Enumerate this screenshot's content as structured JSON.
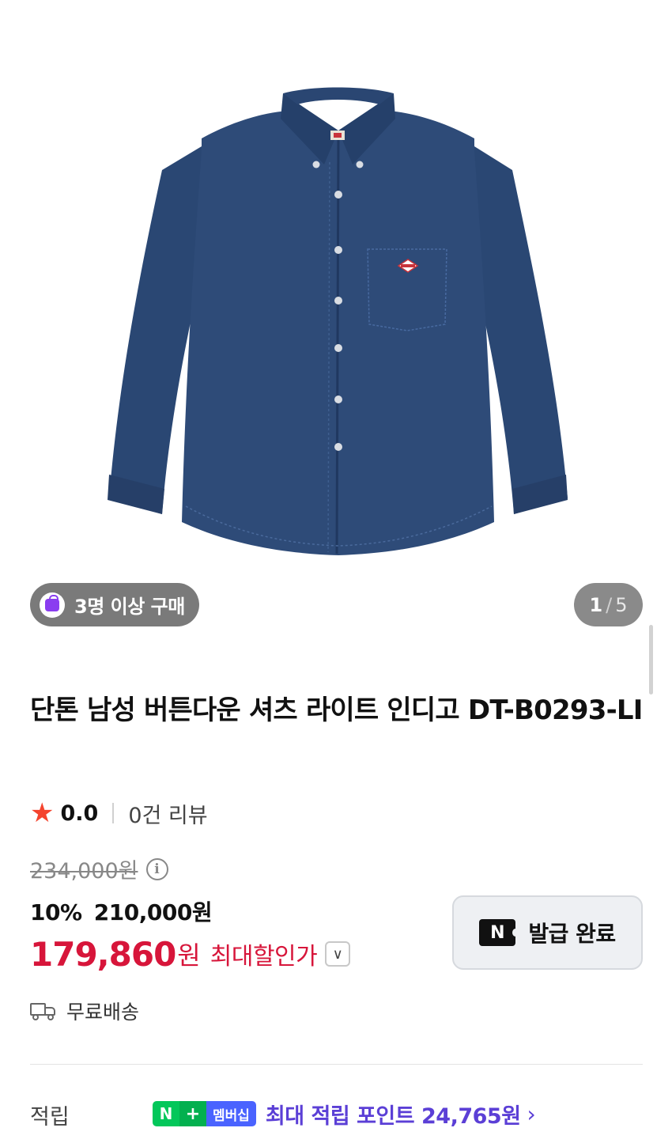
{
  "product_image": {
    "alt_icon": "denim-shirt",
    "colors": {
      "denim": "#2e4b78",
      "denim_dark": "#243d63",
      "stitch": "#5a76a3"
    }
  },
  "group_buy_badge": {
    "label": "3명 이상 구매",
    "icon": "shopping-bag-icon"
  },
  "image_counter": {
    "current": "1",
    "separator": "/",
    "total": "5"
  },
  "product": {
    "title": "단톤 남성 버튼다운 셔츠 라이트 인디고 DT-B0293-LI"
  },
  "rating": {
    "score": "0.0",
    "reviews": "0건 리뷰",
    "icon": "star-icon"
  },
  "price": {
    "original": "234,000원",
    "discount_rate": "10%",
    "sale_price": "210,000원",
    "max_discount_amount": "179,860",
    "max_discount_unit": "원",
    "max_discount_label": "최대할인가"
  },
  "coupon": {
    "badge": "N",
    "label": "발급 완료"
  },
  "shipping": {
    "label": "무료배송"
  },
  "points": {
    "label": "적립",
    "badge_n": "N",
    "badge_plus": "+",
    "badge_membership": "멤버십",
    "text": "최대 적립 포인트 24,765원"
  },
  "colors": {
    "accent_red": "#d7153a",
    "points_purple": "#5b3fd6",
    "naver_green": "#03c75a"
  }
}
